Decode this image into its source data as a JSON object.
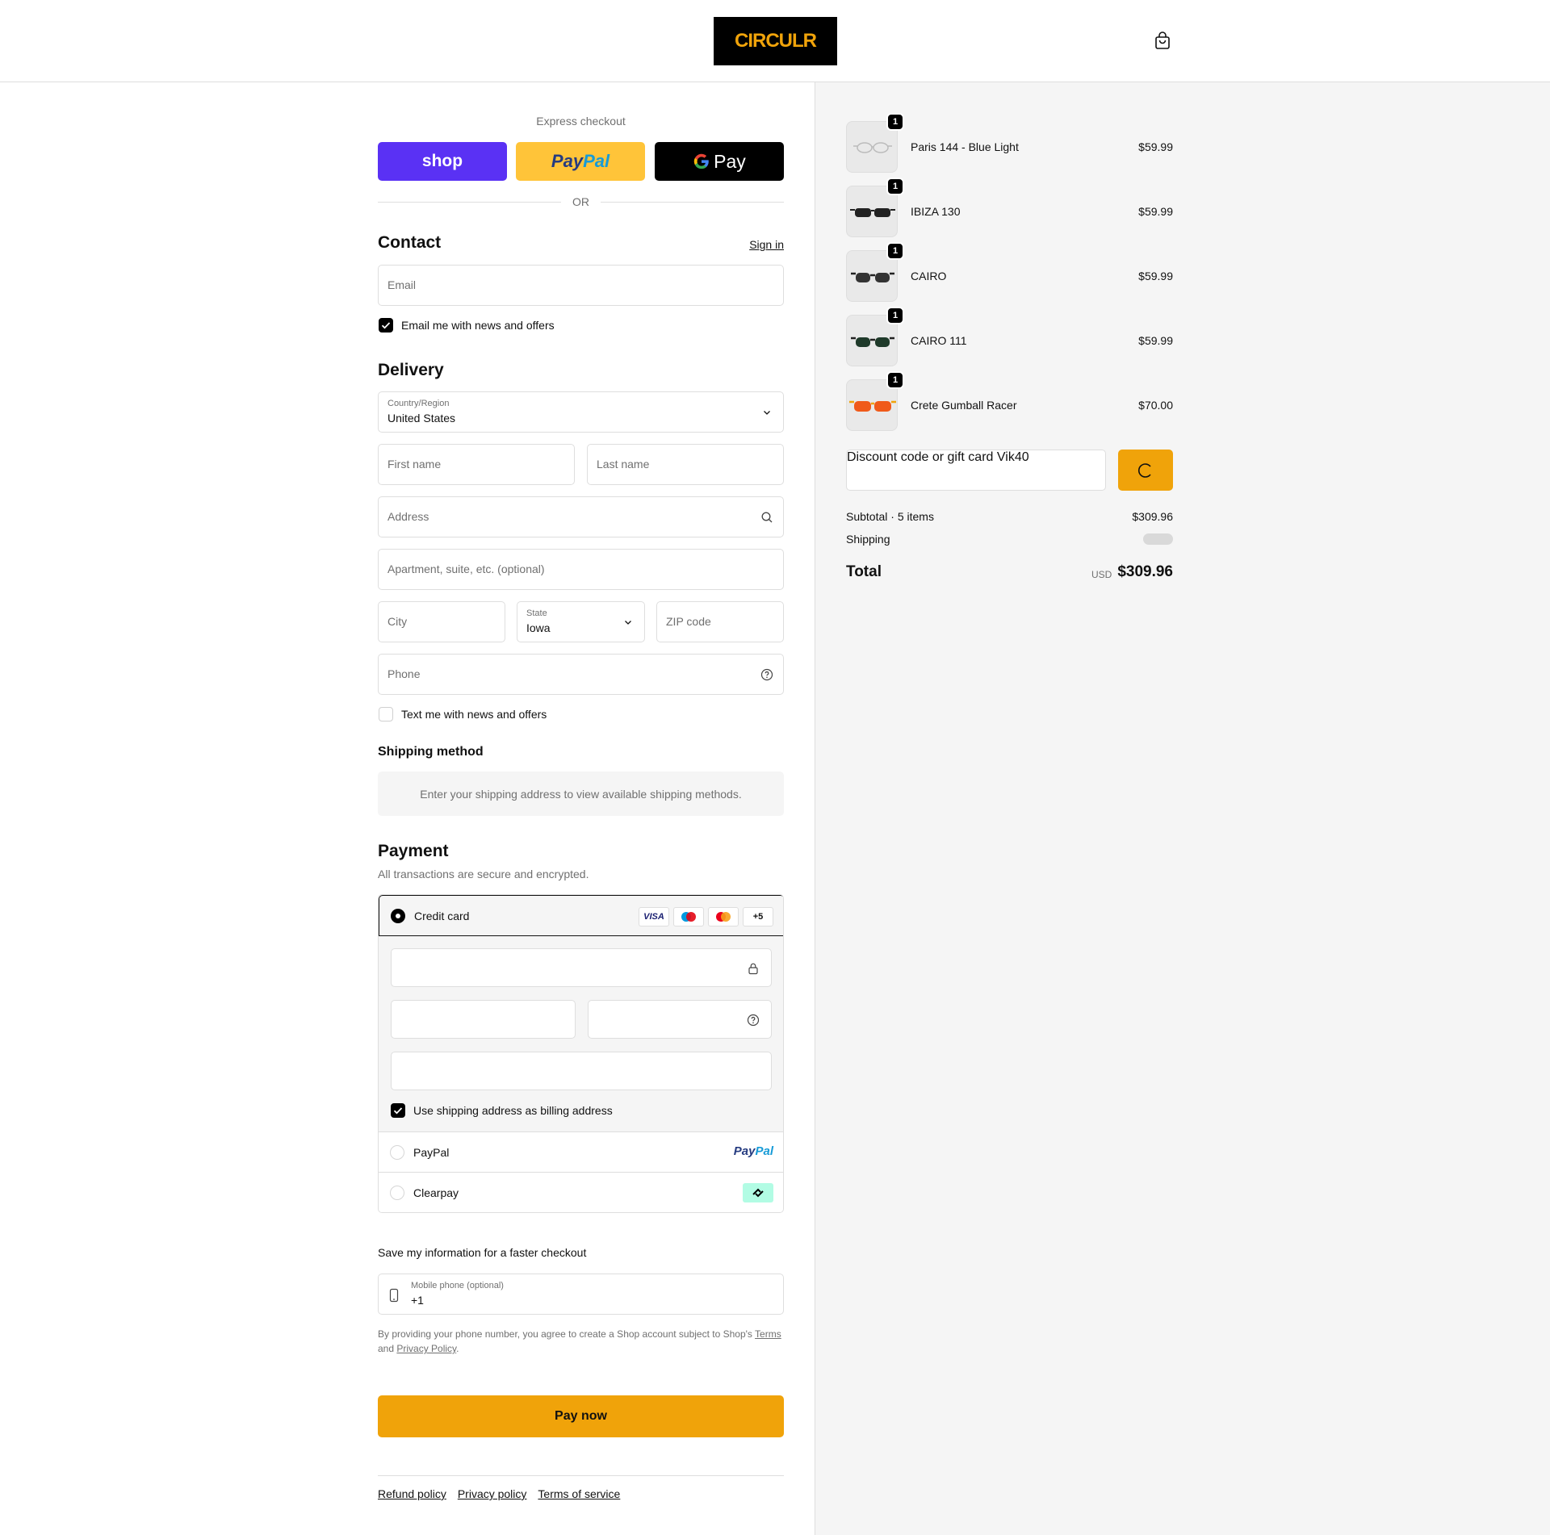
{
  "header": {
    "logo_text": "CIRCULR",
    "cart_icon": "bag-icon"
  },
  "express": {
    "title": "Express checkout",
    "shop_label": "shop",
    "paypal_pay": "Pay",
    "paypal_pal": "Pal",
    "gpay_label": "Pay",
    "or_text": "OR"
  },
  "contact": {
    "title": "Contact",
    "sign_in": "Sign in",
    "email_placeholder": "Email",
    "news_label": "Email me with news and offers"
  },
  "delivery": {
    "title": "Delivery",
    "country_label": "Country/Region",
    "country_value": "United States",
    "first_name_placeholder": "First name",
    "last_name_placeholder": "Last name",
    "address_placeholder": "Address",
    "apartment_placeholder": "Apartment, suite, etc. (optional)",
    "city_placeholder": "City",
    "state_label": "State",
    "state_value": "Iowa",
    "zip_placeholder": "ZIP code",
    "phone_placeholder": "Phone",
    "text_news_label": "Text me with news and offers"
  },
  "shipping_method": {
    "title": "Shipping method",
    "message": "Enter your shipping address to view available shipping methods."
  },
  "payment": {
    "title": "Payment",
    "subtitle": "All transactions are secure and encrypted.",
    "credit_card_label": "Credit card",
    "card_logos": [
      "VISA",
      "+5"
    ],
    "billing_label": "Use shipping address as billing address",
    "paypal_label": "PayPal",
    "paypal_logo_pay": "Pay",
    "paypal_logo_pal": "Pal",
    "clearpay_label": "Clearpay"
  },
  "save_info": {
    "title": "Save my information for a faster checkout",
    "mobile_label": "Mobile phone (optional)",
    "mobile_value": "+1",
    "legal_prefix": "By providing your phone number, you agree to create a Shop account subject to Shop's",
    "terms_link": "Terms",
    "and_text": "and",
    "privacy_link": "Privacy Policy",
    "period": "."
  },
  "pay_now_label": "Pay now",
  "footer": {
    "links": [
      "Refund policy",
      "Privacy policy",
      "Terms of service"
    ]
  },
  "order": {
    "items": [
      {
        "name": "Paris 144 - Blue Light",
        "price": "$59.99",
        "qty": "1"
      },
      {
        "name": "IBIZA 130",
        "price": "$59.99",
        "qty": "1"
      },
      {
        "name": "CAIRO",
        "price": "$59.99",
        "qty": "1"
      },
      {
        "name": "CAIRO 111",
        "price": "$59.99",
        "qty": "1"
      },
      {
        "name": "Crete Gumball Racer",
        "price": "$70.00",
        "qty": "1"
      }
    ],
    "discount_label": "Discount code or gift card",
    "discount_value": "Vik40",
    "subtotal_label": "Subtotal · 5 items",
    "subtotal_value": "$309.96",
    "shipping_label": "Shipping",
    "total_label": "Total",
    "total_currency": "USD",
    "total_value": "$309.96"
  },
  "colors": {
    "accent": "#f0a30a",
    "shop_purple": "#5a31f4",
    "paypal_yellow": "#ffc439"
  }
}
